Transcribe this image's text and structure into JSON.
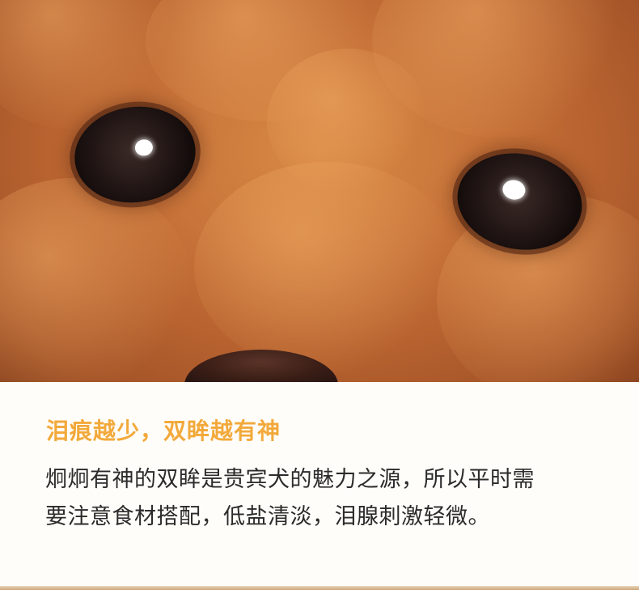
{
  "photo": {
    "subject": "poodle-face-closeup",
    "fur_color": "#c8743a"
  },
  "caption": {
    "headline": "泪痕越少，双眸越有神",
    "body_lines": [
      "炯炯有神的双眸是贵宾犬的魅力之源，所以平时需",
      "要注意食材搭配，低盐清淡，泪腺刺激轻微。"
    ],
    "headline_color": "#f2a93b",
    "text_color": "#2b2b2b"
  }
}
